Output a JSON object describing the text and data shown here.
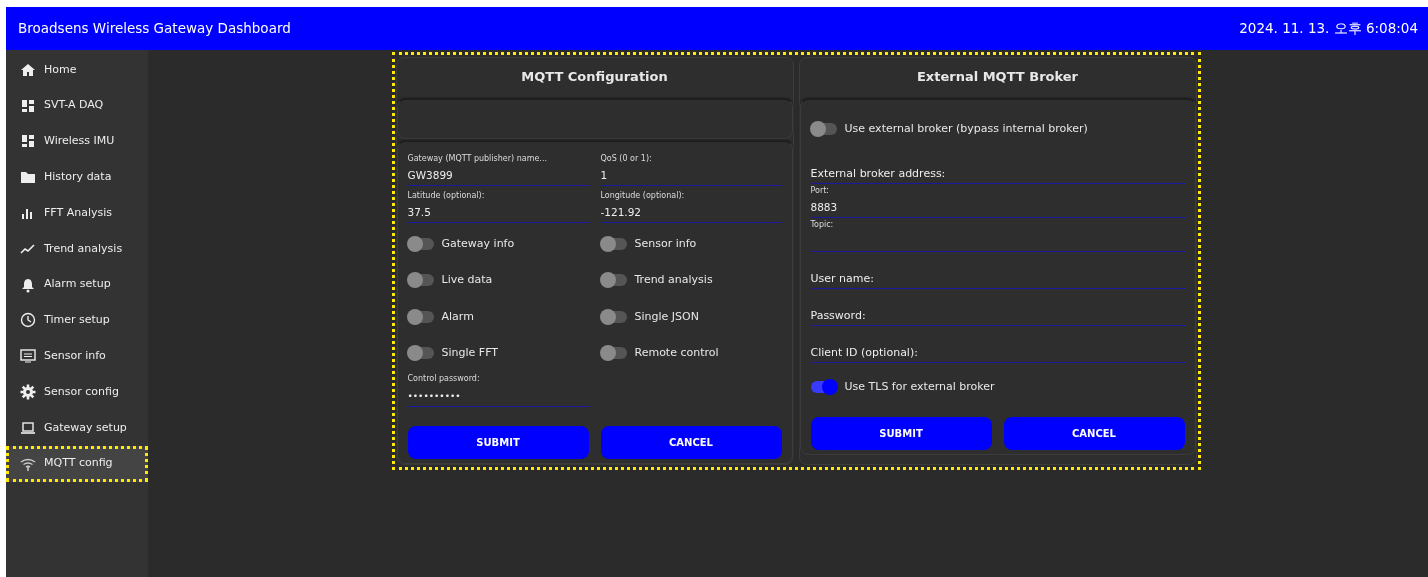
{
  "header": {
    "title": "Broadsens Wireless Gateway Dashboard",
    "datetime": "2024. 11. 13. 오후 6:08:04"
  },
  "sidebar": {
    "items": [
      {
        "label": "Home",
        "selected": false,
        "highlighted": false
      },
      {
        "label": "SVT-A DAQ",
        "selected": false,
        "highlighted": false
      },
      {
        "label": "Wireless IMU",
        "selected": false,
        "highlighted": false
      },
      {
        "label": "History data",
        "selected": false,
        "highlighted": false
      },
      {
        "label": "FFT Analysis",
        "selected": false,
        "highlighted": false
      },
      {
        "label": "Trend analysis",
        "selected": false,
        "highlighted": false
      },
      {
        "label": "Alarm setup",
        "selected": false,
        "highlighted": false
      },
      {
        "label": "Timer setup",
        "selected": false,
        "highlighted": false
      },
      {
        "label": "Sensor info",
        "selected": false,
        "highlighted": false
      },
      {
        "label": "Sensor config",
        "selected": false,
        "highlighted": false
      },
      {
        "label": "Gateway setup",
        "selected": false,
        "highlighted": false
      },
      {
        "label": "MQTT config",
        "selected": true,
        "highlighted": true
      }
    ]
  },
  "main": {
    "highlighted": true,
    "mqtt_configuration": {
      "title": "MQTT Configuration",
      "fields": [
        {
          "label": "Gateway (MQTT publisher) name...",
          "value": "GW3899"
        },
        {
          "label": "QoS (0 or 1):",
          "value": "1"
        },
        {
          "label": "Latitude (optional):",
          "value": "37.5"
        },
        {
          "label": "Longitude (optional):",
          "value": "-121.92"
        }
      ],
      "toggles": [
        {
          "label": "Gateway info",
          "on": false
        },
        {
          "label": "Sensor info",
          "on": false
        },
        {
          "label": "Live data",
          "on": false
        },
        {
          "label": "Trend analysis",
          "on": false
        },
        {
          "label": "Alarm",
          "on": false
        },
        {
          "label": "Single JSON",
          "on": false
        },
        {
          "label": "Single FFT",
          "on": false
        },
        {
          "label": "Remote control",
          "on": false
        }
      ],
      "password": {
        "label": "Control password:",
        "value": "••••••••••"
      },
      "buttons": [
        "SUBMIT",
        "CANCEL"
      ]
    },
    "external_broker": {
      "title": "External MQTT Broker",
      "use_external": {
        "label": "Use external broker (bypass internal broker)",
        "on": false
      },
      "fields": [
        {
          "kind": "placeholder",
          "placeholder": "External broker address:"
        },
        {
          "kind": "labeled",
          "label": "Port:",
          "value": "8883"
        },
        {
          "kind": "labeled",
          "label": "Topic:"
        },
        {
          "kind": "placeholder",
          "placeholder": "User name:"
        },
        {
          "kind": "placeholder",
          "placeholder": "Password:"
        },
        {
          "kind": "placeholder",
          "placeholder": "Client ID (optional):"
        }
      ],
      "use_tls": {
        "label": "Use TLS for external broker",
        "on": true
      },
      "buttons": [
        "SUBMIT",
        "CANCEL"
      ]
    }
  }
}
